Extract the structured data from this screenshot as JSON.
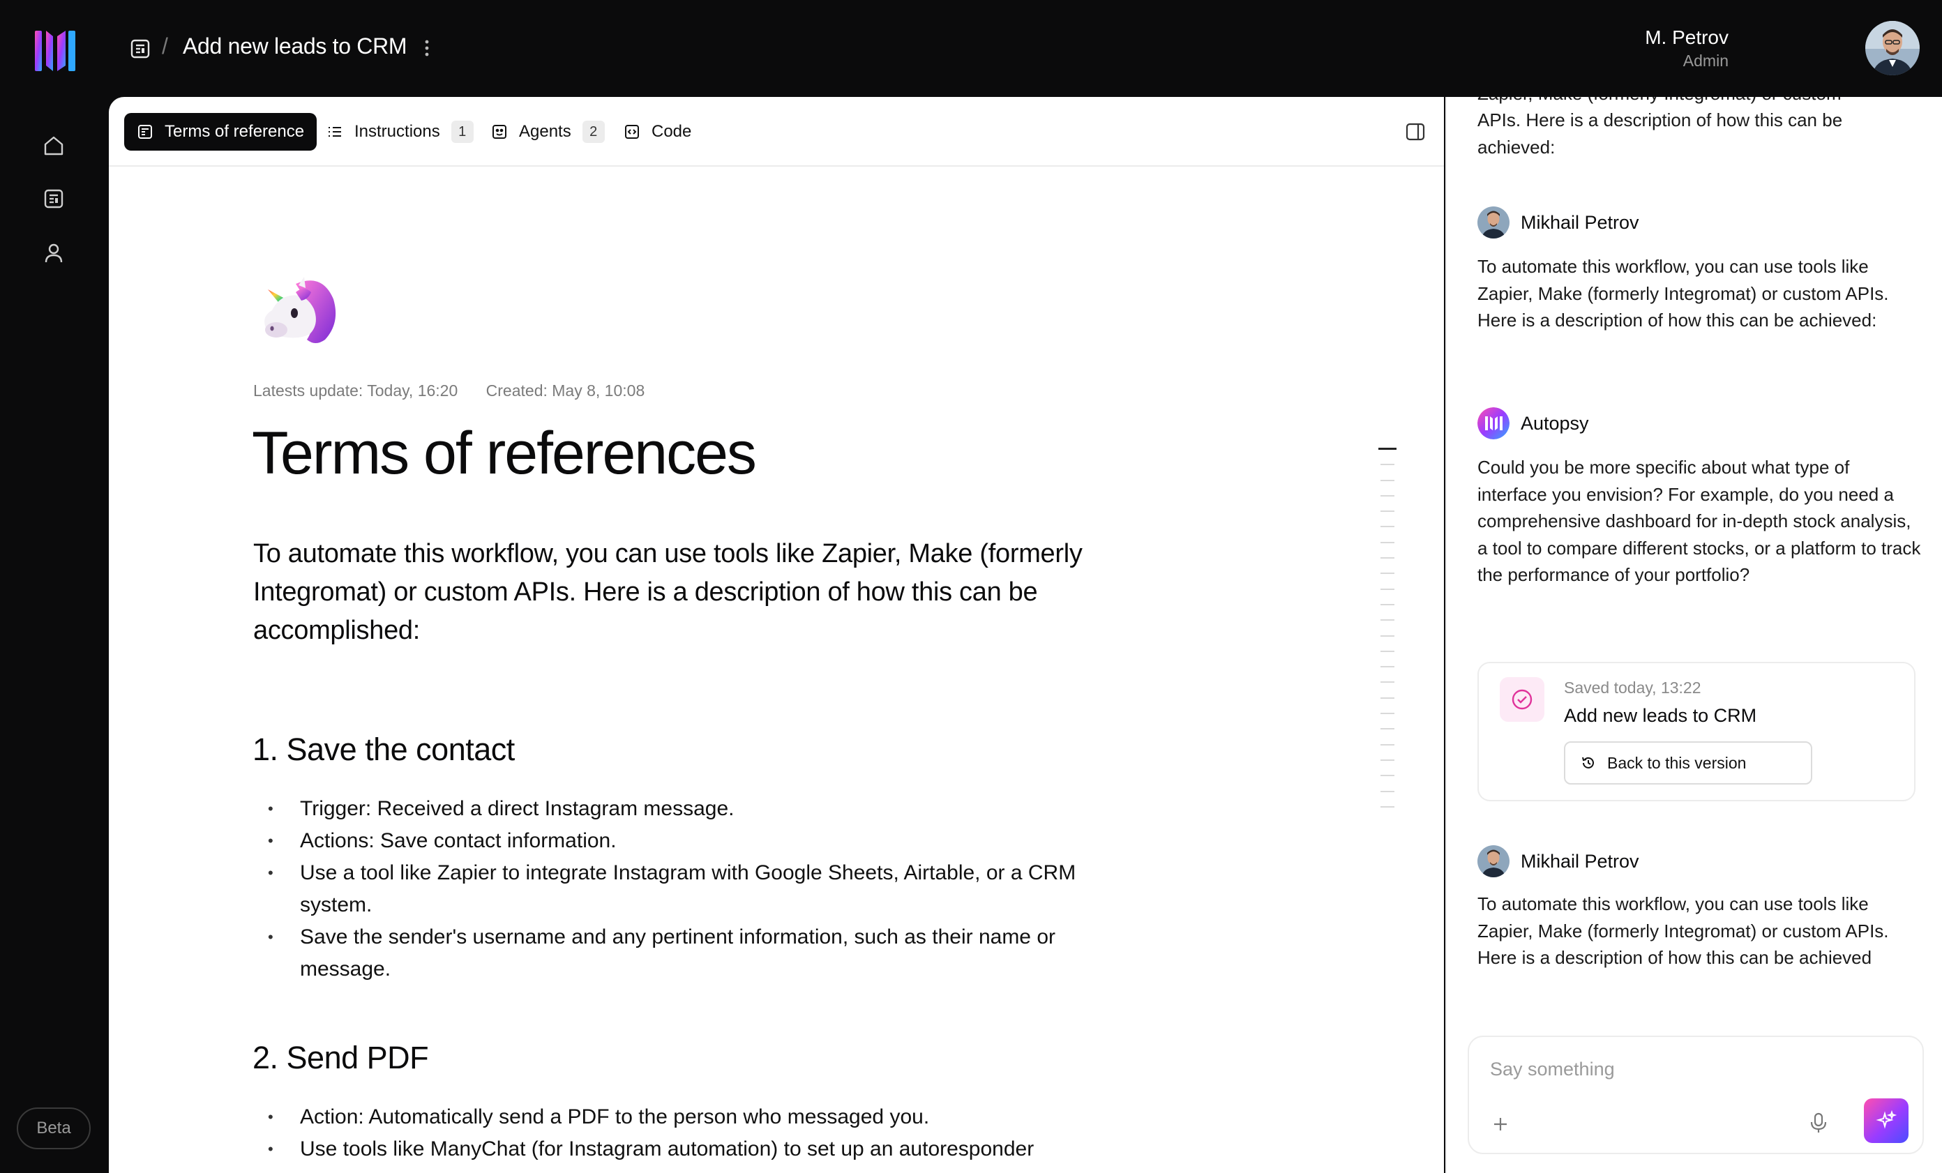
{
  "header": {
    "breadcrumb_separator": "/",
    "title": "Add new leads to CRM",
    "user_name": "M. Petrov",
    "user_role": "Admin"
  },
  "sidebar": {
    "icons": [
      "home-icon",
      "document-icon",
      "user-icon"
    ],
    "beta_label": "Beta"
  },
  "tabs": [
    {
      "label": "Terms of reference",
      "icon": "document-icon",
      "active": true
    },
    {
      "label": "Instructions",
      "icon": "list-icon",
      "count": "1"
    },
    {
      "label": "Agents",
      "icon": "agent-icon",
      "count": "2"
    },
    {
      "label": "Code",
      "icon": "code-icon"
    }
  ],
  "document": {
    "emoji": "unicorn",
    "updated": "Latests update: Today, 16:20",
    "created": "Created: May 8, 10:08",
    "title": "Terms of references",
    "lead": "To automate this workflow, you can use tools like Zapier, Make (formerly Integromat) or custom APIs. Here is a description of how this can be accomplished:",
    "sections": [
      {
        "heading": "1. Save the contact",
        "bullets": [
          "Trigger: Received a direct Instagram message.",
          "Actions: Save contact information.",
          "Use a tool like Zapier to integrate Instagram with Google Sheets, Airtable, or a CRM system.",
          "Save the sender's username and any pertinent information, such as their name or message."
        ]
      },
      {
        "heading": "2. Send PDF",
        "bullets": [
          "Action: Automatically send a PDF to the person who messaged you.",
          "Use tools like ManyChat (for Instagram automation) to set up an autoresponder"
        ]
      }
    ]
  },
  "chat": {
    "top_partial_line": "Zapier, Make (formerly Integromat) or custom",
    "top_partial_text": "APIs. Here is a description of how this can be achieved:",
    "messages": [
      {
        "author": "Mikhail Petrov",
        "text": "To automate this workflow, you can use tools like Zapier, Make (formerly Integromat) or custom APIs. Here is a description of how this can be achieved:"
      },
      {
        "author": "Autopsy",
        "text": "Could you be more specific about what type of interface you envision? For example, do you need a comprehensive dashboard for in-depth stock analysis, a tool to compare different stocks, or a platform to track the performance of your portfolio?"
      },
      {
        "author": "Mikhail Petrov",
        "text": "To automate this workflow, you can use tools like Zapier, Make (formerly Integromat) or custom APIs. Here is a description of how this can be achieved"
      }
    ],
    "saved_card": {
      "time": "Saved today, 13:22",
      "title": "Add new leads to CRM",
      "button": "Back to this version"
    },
    "composer_placeholder": "Say something"
  },
  "colors": {
    "background": "#0b0b0c",
    "accent_gradient_start": "#ff4fb0",
    "accent_gradient_end": "#4a4dff",
    "saved_icon_bg": "#fdeaf6"
  }
}
